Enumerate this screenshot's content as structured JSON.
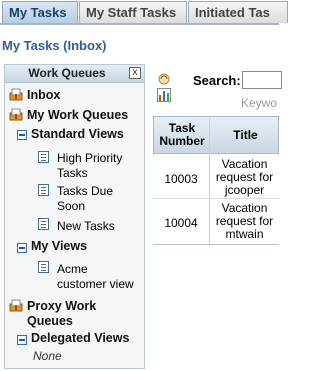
{
  "tabs": [
    {
      "label": "My Tasks",
      "active": true
    },
    {
      "label": "My Staff Tasks",
      "active": false
    },
    {
      "label": "Initiated Tas",
      "active": false
    }
  ],
  "page": {
    "title": "My Tasks (Inbox)"
  },
  "work_queues": {
    "header": "Work Queues",
    "close_glyph": "x",
    "inbox": "Inbox",
    "my_work_queues": "My Work Queues",
    "standard_views": {
      "label": "Standard Views",
      "items": [
        "High Priority Tasks",
        "Tasks Due Soon",
        "New Tasks"
      ]
    },
    "my_views": {
      "label": "My Views",
      "items": [
        "Acme customer view"
      ]
    },
    "proxy_work_queues": "Proxy Work Queues",
    "delegated_views": {
      "label": "Delegated Views",
      "empty_text": "None"
    }
  },
  "search": {
    "label": "Search:",
    "value": "",
    "hint": "Keywo"
  },
  "task_table": {
    "columns": [
      "Task Number",
      "Title"
    ],
    "rows": [
      {
        "task_number": "10003",
        "title": "Vacation request for jcooper"
      },
      {
        "task_number": "10004",
        "title": "Vacation request for mtwain"
      }
    ]
  }
}
